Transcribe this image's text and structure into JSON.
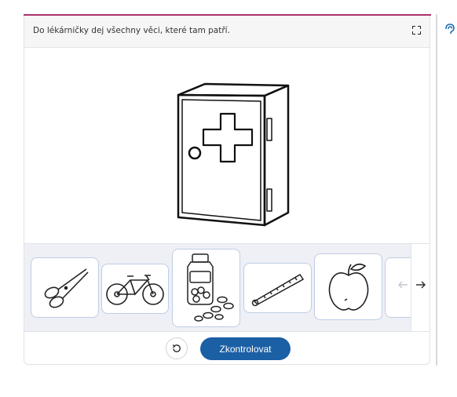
{
  "task": {
    "instruction": "Do lékárničky dej všechny věci, které tam patří."
  },
  "icons": {
    "fullscreen": "fullscreen-icon",
    "reset": "reset-icon",
    "prev": "arrow-left-icon",
    "next": "arrow-right-icon",
    "side": "listen-icon"
  },
  "tray": {
    "items": [
      "scissors",
      "bicycle",
      "pills",
      "thermometer",
      "apple"
    ]
  },
  "footer": {
    "check_label": "Zkontrolovat"
  },
  "colors": {
    "accent_top": "#a8336a",
    "primary_button": "#1b5fa5",
    "tray_bg": "#eef0f5",
    "item_border": "#bfcde6"
  }
}
